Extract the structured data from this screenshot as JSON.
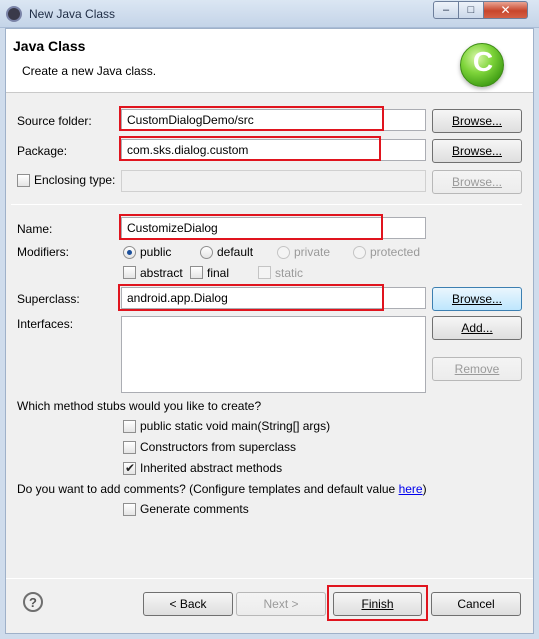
{
  "window": {
    "title": "New Java Class",
    "minimize": "–",
    "maximize": "□",
    "close": "✕"
  },
  "header": {
    "title": "Java Class",
    "description": "Create a new Java class.",
    "logo_letter": "C"
  },
  "source_folder": {
    "label": "Source folder:",
    "value": "CustomDialogDemo/src",
    "browse": "Browse..."
  },
  "package": {
    "label": "Package:",
    "value": "com.sks.dialog.custom",
    "browse": "Browse..."
  },
  "enclosing_type": {
    "label": "Enclosing type:",
    "value": "",
    "browse": "Browse..."
  },
  "name": {
    "label": "Name:",
    "value": "CustomizeDialog"
  },
  "modifiers": {
    "label": "Modifiers:",
    "public": "public",
    "default": "default",
    "private": "private",
    "protected": "protected",
    "abstract": "abstract",
    "final": "final",
    "static": "static"
  },
  "superclass": {
    "label": "Superclass:",
    "value": "android.app.Dialog",
    "browse": "Browse..."
  },
  "interfaces": {
    "label": "Interfaces:",
    "add": "Add...",
    "remove": "Remove"
  },
  "stubs": {
    "question": "Which method stubs would you like to create?",
    "main": "public static void main(String[] args)",
    "constructors": "Constructors from superclass",
    "inherited": "Inherited abstract methods"
  },
  "comments": {
    "question": "Do you want to add comments? (Configure templates and default value ",
    "link": "here",
    "close_paren": ")",
    "generate": "Generate comments"
  },
  "footer": {
    "help": "?",
    "back": "< Back",
    "next": "Next >",
    "finish": "Finish",
    "cancel": "Cancel"
  }
}
